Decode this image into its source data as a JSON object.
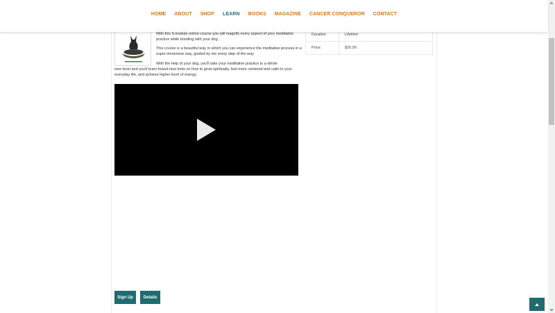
{
  "nav": {
    "items": [
      {
        "label": "HOME"
      },
      {
        "label": "ABOUT"
      },
      {
        "label": "SHOP"
      },
      {
        "label": "LEARN"
      },
      {
        "label": "BOOKS"
      },
      {
        "label": "MAGAZINE"
      },
      {
        "label": "CANCER CONQUEROR"
      },
      {
        "label": "CONTACT"
      }
    ],
    "active": "LEARN",
    "accent_color": "#d97a1c",
    "active_color": "#2a6f75"
  },
  "course": {
    "desc_1": "With this 5-module online course you will magnify every aspect of your meditation practice while bonding with your dog.",
    "desc_2": "This course is a beautiful way in which you can experience the meditative process in a super immersive way, guided by me every step of the way.",
    "desc_3a": "With the help of your dog, you'll take your meditative practice to a whole",
    "desc_3b": "new level and you'll learn brand-new tools on how to grow spiritually, feel more centered and calm in your everyday life, and achieve higher level of energy.",
    "video": {
      "icon": "play-icon"
    }
  },
  "details_table": [
    {
      "key": "Duration",
      "value": "Lifetime"
    },
    {
      "key": "Price:",
      "value": "$20.00"
    }
  ],
  "buttons": {
    "signup_label": "Sign Up",
    "details_label": "Details",
    "color": "#1f6b72"
  },
  "back_to_top": {
    "icon": "arrow-up-icon"
  }
}
